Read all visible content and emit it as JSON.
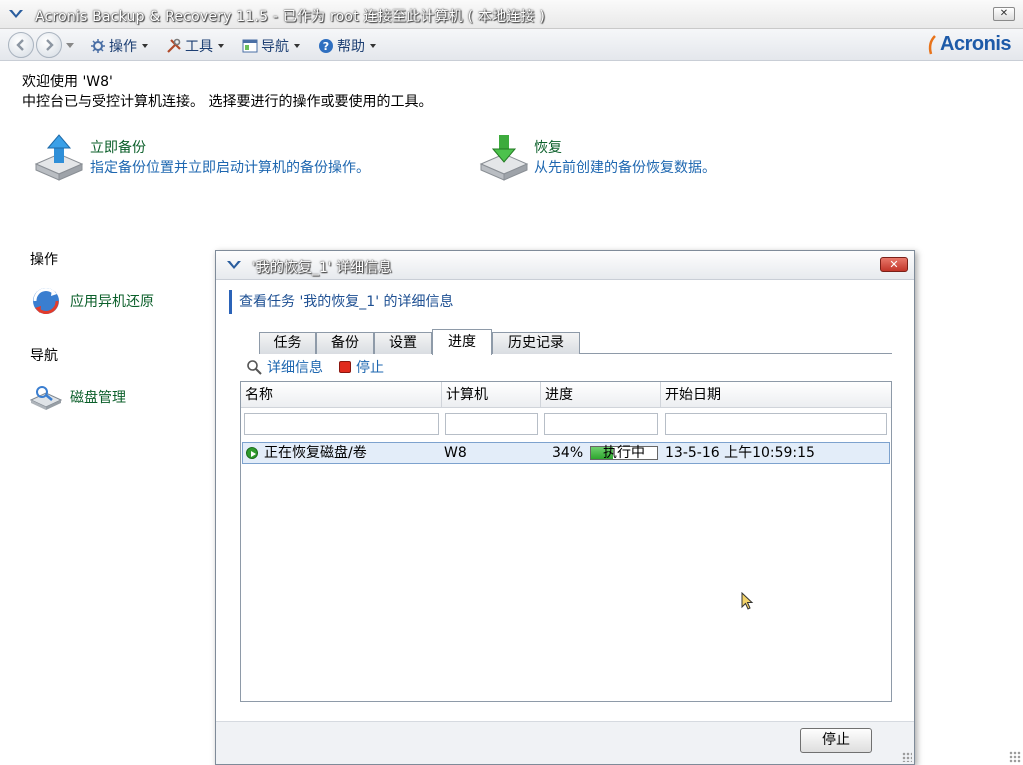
{
  "window": {
    "title": "Acronis Backup & Recovery 11.5 - 已作为 root 连接至此计算机 ( 本地连接 )",
    "close_label": "✕"
  },
  "menubar": {
    "items": [
      {
        "label": "操作",
        "icon": "actions-icon"
      },
      {
        "label": "工具",
        "icon": "tools-icon"
      },
      {
        "label": "导航",
        "icon": "navigation-icon"
      },
      {
        "label": "帮助",
        "icon": "help-icon"
      }
    ],
    "brand": "Acronis"
  },
  "welcome": {
    "line1": "欢迎使用 'W8'",
    "line2": "中控台已与受控计算机连接。 选择要进行的操作或要使用的工具。"
  },
  "quick_actions": [
    {
      "title": "立即备份",
      "description": "指定备份位置并立即启动计算机的备份操作。"
    },
    {
      "title": "恢复",
      "description": "从先前创建的备份恢复数据。"
    }
  ],
  "sidebar": {
    "actions_heading": "操作",
    "actions": [
      {
        "label": "应用异机还原"
      }
    ],
    "nav_heading": "导航",
    "nav": [
      {
        "label": "磁盘管理"
      }
    ]
  },
  "dialog": {
    "title": "'我的恢复_1' 详细信息",
    "close_label": "✕",
    "heading": "查看任务 '我的恢复_1' 的详细信息",
    "tabs": [
      "任务",
      "备份",
      "设置",
      "进度",
      "历史记录"
    ],
    "active_tab": "进度",
    "toolbar": {
      "details_label": "详细信息",
      "stop_label": "停止"
    },
    "table": {
      "columns": [
        "名称",
        "计算机",
        "进度",
        "开始日期"
      ],
      "rows": [
        {
          "name": "正在恢复磁盘/卷",
          "computer": "W8",
          "percent": "34%",
          "progress": 0.34,
          "state": "执行中",
          "start": "13-5-16 上午10:59:15"
        }
      ]
    },
    "footer": {
      "stop_button": "停止"
    }
  },
  "colors": {
    "accent": "#1e67b0",
    "link_green": "#0b5f2a",
    "progress_green": "#2ea62e"
  }
}
